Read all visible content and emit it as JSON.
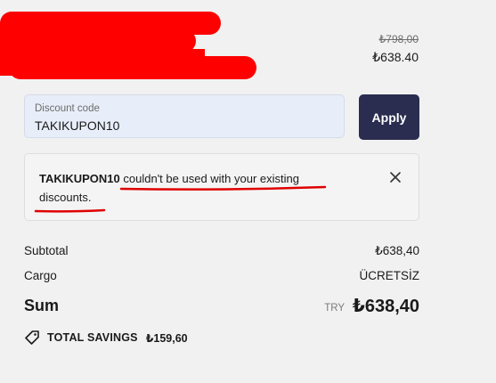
{
  "product": {
    "original_price": "₺798,00",
    "price": "₺638.40"
  },
  "discount": {
    "label": "Discount code",
    "value": "TAKIKUPON10",
    "apply_label": "Apply"
  },
  "error": {
    "code": "TAKIKUPON10",
    "message": " couldn't be used with your existing discounts."
  },
  "summary": {
    "subtotal_label": "Subtotal",
    "subtotal_value": "₺638,40",
    "cargo_label": "Cargo",
    "cargo_value": "ÜCRETSİZ",
    "sum_label": "Sum",
    "currency": "TRY",
    "sum_value": "₺638,40",
    "savings_label": "TOTAL SAVINGS",
    "savings_value": "₺159,60"
  },
  "colors": {
    "apply_button": "#2a2d4f",
    "annotation_red": "#e00000",
    "input_background": "#e8eef9"
  }
}
